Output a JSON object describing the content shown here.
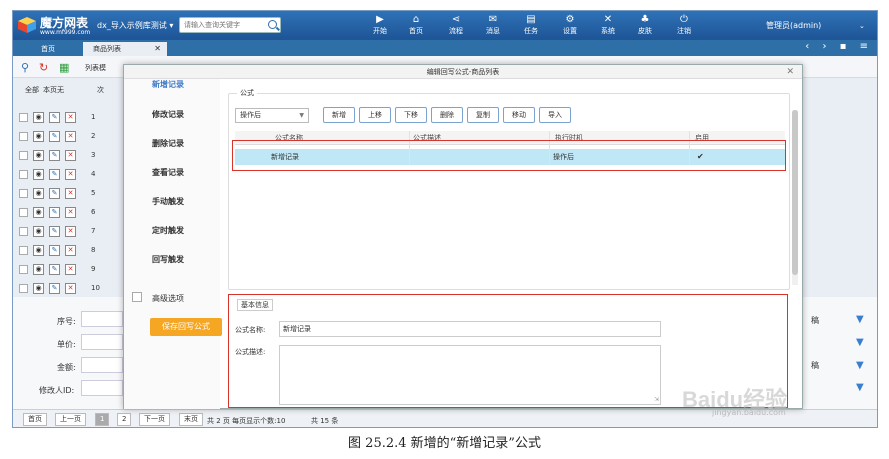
{
  "app": {
    "logo_title": "魔方网表",
    "logo_url": "www.mf999.com",
    "project": "dx_导入示例库测试 ▾",
    "search_placeholder": "请输入查询关键字",
    "nav": [
      {
        "icon": "▶",
        "label": "开始"
      },
      {
        "icon": "⌂",
        "label": "首页"
      },
      {
        "icon": "⋖",
        "label": "流程"
      },
      {
        "icon": "✉",
        "label": "消息"
      },
      {
        "icon": "▤",
        "label": "任务"
      },
      {
        "icon": "⚙",
        "label": "设置"
      },
      {
        "icon": "✕",
        "label": "系统"
      },
      {
        "icon": "♣",
        "label": "皮肤"
      },
      {
        "icon": "⏻",
        "label": "注销"
      }
    ],
    "user": "管理员(admin)",
    "user_caret": "⌄"
  },
  "tabs": {
    "home": "首页",
    "products": "商品列表",
    "close": "✕",
    "controls": "‹ › ▪ ≡"
  },
  "grid": {
    "header_all": "全部",
    "header_version": "本页无",
    "header_rank": "次",
    "list_mode": "列表模",
    "rows": [
      "1",
      "2",
      "3",
      "4",
      "5",
      "6",
      "7",
      "8",
      "9",
      "10"
    ]
  },
  "lower_form": {
    "seq_label": "序号:",
    "price_label": "单价:",
    "amount_label": "金额:",
    "modifier_label": "修改人ID:",
    "right_label_1": "稿",
    "right_label_2": "稿"
  },
  "pager": {
    "first": "首页",
    "prev": "上一页",
    "page1": "1",
    "page2": "2",
    "next": "下一页",
    "last": "末页",
    "info": "共 2 页 每页显示个数:10",
    "total": "共 15 条"
  },
  "dialog": {
    "title": "编辑回写公式-商品列表",
    "close": "✕",
    "menu": [
      "新增记录",
      "修改记录",
      "删除记录",
      "查看记录",
      "手动触发",
      "定时触发",
      "回写触发"
    ],
    "advanced": "高级选项",
    "save": "保存回写公式",
    "formula_legend": "公式",
    "timing_select": "操作后",
    "actions": [
      "新增",
      "上移",
      "下移",
      "删除",
      "复制",
      "移动",
      "导入"
    ],
    "columns": [
      "公式名称",
      "公式描述",
      "执行时机",
      "启用"
    ],
    "row": {
      "name": "新增记录",
      "desc": "",
      "timing": "操作后",
      "enabled": "✔"
    },
    "basic_legend": "基本信息",
    "name_label": "公式名称:",
    "name_value": "新增记录",
    "desc_label": "公式描述:"
  },
  "caption": "图 25.2.4  新增的“新增记录”公式",
  "watermark": "Baidu经验",
  "watermark_sub": "jingyan.baidu.com",
  "colors": {
    "accent": "#1d5596",
    "highlight_row": "#bfe7f6",
    "red_box": "#d9342b",
    "save_button": "#f5a623"
  }
}
